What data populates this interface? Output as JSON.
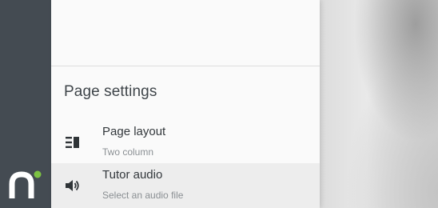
{
  "rail": {
    "brand_logo": "n-logo",
    "accent": "#7cc242",
    "background": "#444b52"
  },
  "settings": {
    "title": "Page settings",
    "items": [
      {
        "label": "Page layout",
        "value": "Two column",
        "icon": "two-column-layout-icon"
      },
      {
        "label": "Tutor audio",
        "value": "Select an audio file",
        "icon": "speaker-icon"
      }
    ]
  }
}
